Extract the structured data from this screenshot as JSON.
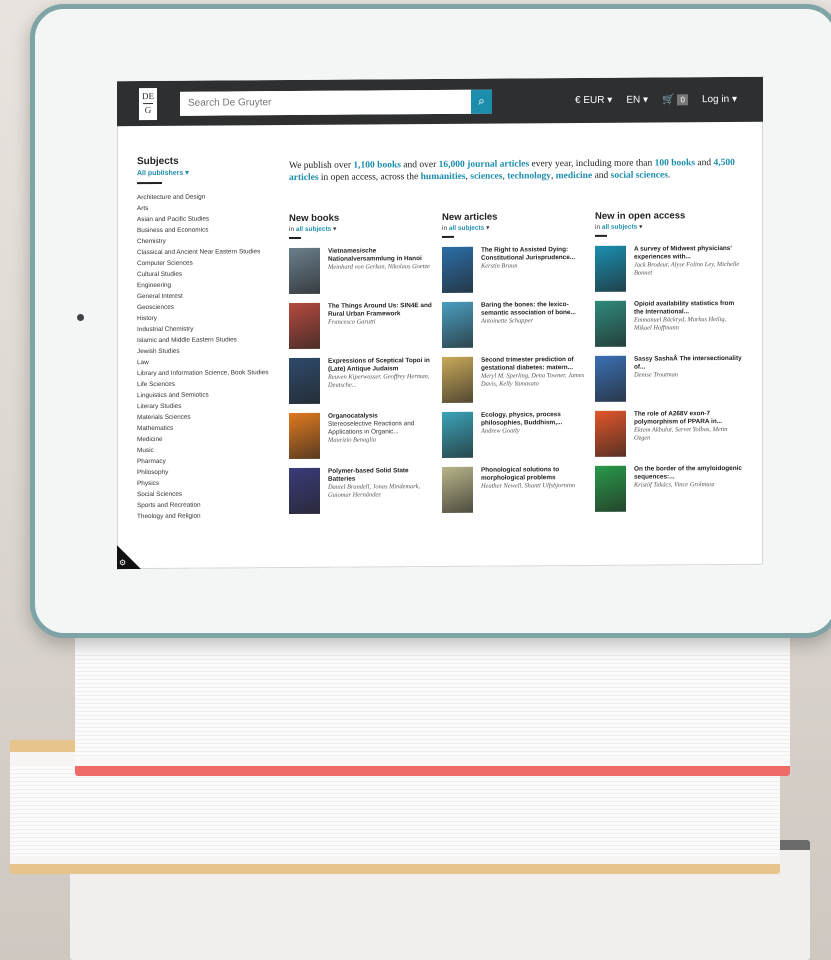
{
  "header": {
    "logo_top": "DE",
    "logo_bottom": "G",
    "search_placeholder": "Search De Gruyter",
    "currency": "€ EUR",
    "language": "EN",
    "cart_count": "0",
    "login": "Log in"
  },
  "subjects": {
    "title": "Subjects",
    "filter": "All publishers",
    "items": [
      "Architecture and Design",
      "Arts",
      "Asian and Pacific Studies",
      "Business and Economics",
      "Chemistry",
      "Classical and Ancient Near Eastern Studies",
      "Computer Sciences",
      "Cultural Studies",
      "Engineering",
      "General Interest",
      "Geosciences",
      "History",
      "Industrial Chemistry",
      "Islamic and Middle Eastern Studies",
      "Jewish Studies",
      "Law",
      "Library and Information Science, Book Studies",
      "Life Sciences",
      "Linguistics and Semiotics",
      "Literary Studies",
      "Materials Sciences",
      "Mathematics",
      "Medicine",
      "Music",
      "Pharmacy",
      "Philosophy",
      "Physics",
      "Social Sciences",
      "Sports and Recreation",
      "Theology and Religion"
    ]
  },
  "intro": {
    "p1": "We publish over ",
    "books": "1,100 books",
    "p2": " and over ",
    "journals": "16,000 journal articles",
    "p3": " every year, including more than ",
    "oa_books": "100 books",
    "p4": " and ",
    "oa_articles": "4,500 articles",
    "p5": " in open access, across the ",
    "humanities": "humanities",
    "sep1": ", ",
    "sciences": "sciences",
    "sep2": ", ",
    "technology": "technology",
    "sep3": ", ",
    "medicine": "medicine",
    "p6": " and ",
    "social": "social sciences",
    "p7": "."
  },
  "columns": [
    {
      "title": "New books",
      "filter_prefix": "in",
      "filter": "all subjects",
      "items": [
        {
          "title": "Vietnamesische Nationalversammlung in Hanoi",
          "authors": "Meinhard von Gerkan, Nikolaus Goetze",
          "color": "#6b7f8c"
        },
        {
          "title": "The Things Around Us: SIN4E and Rural Urban Framework",
          "authors": "Francesco Garutti",
          "color": "#b44a3e"
        },
        {
          "title": "Expressions of Sceptical Topoi in (Late) Antique Judaism",
          "authors": "Reuven Kiperwasser, Geoffrey Herman, Deutsche...",
          "color": "#2e4a6b"
        },
        {
          "title": "Organocatalysis",
          "subtitle": "Stereoselective Reactions and Applications in Organic...",
          "authors": "Maurizio Benaglia",
          "color": "#e07a1f"
        },
        {
          "title": "Polymer-based Solid State Batteries",
          "authors": "Daniel Brandell, Jonas Mindemark, Guiomar Hernández",
          "color": "#3b3b7a"
        }
      ]
    },
    {
      "title": "New articles",
      "filter_prefix": "in",
      "filter": "all subjects",
      "items": [
        {
          "title": "The Right to Assisted Dying: Constitutional Jurisprudence...",
          "authors": "Kerstin Braun",
          "color": "#2b6ea8"
        },
        {
          "title": "Baring the bones: the lexico-semantic association of bone...",
          "authors": "Antoinette Schapper",
          "color": "#4a9ec0"
        },
        {
          "title": "Second trimester prediction of gestational diabetes: matern...",
          "authors": "Meryl M. Sperling, Dena Towner, James Davis, Kelly Yamasato",
          "color": "#c9a95a"
        },
        {
          "title": "Ecology, physics, process philosophies, Buddhism,...",
          "authors": "Andrew Goatly",
          "color": "#3aa3b8"
        },
        {
          "title": "Phonological solutions to morphological problems",
          "authors": "Heather Newell, Shanti Ulfsbjorninn",
          "color": "#b9b58a"
        }
      ]
    },
    {
      "title": "New in open access",
      "filter_prefix": "in",
      "filter": "all subjects",
      "items": [
        {
          "title": "A survey of Midwest physicians' experiences with...",
          "authors": "Jack Brodeur, Alyse Folino Ley, Michelle Bonnet",
          "color": "#1a8fb0"
        },
        {
          "title": "Opioid availability statistics from the International...",
          "authors": "Emmanuel Bäckryd, Markus Heilig, Mikael Hoffmann",
          "color": "#2f8a7c"
        },
        {
          "title": "Sassy SashaÂ The intersectionality of...",
          "authors": "Denise Troutman",
          "color": "#3a6fb3"
        },
        {
          "title": "The role of A268V exon-7 polymorphism of PPARA in...",
          "authors": "Ekrem Akbulut, Servet Yolbas, Metin Ozgen",
          "color": "#e2562b"
        },
        {
          "title": "On the border of the amyloidogenic sequences:...",
          "authors": "Kristóf Takács, Vince Grolmusz",
          "color": "#2a9a4a"
        }
      ]
    }
  ]
}
